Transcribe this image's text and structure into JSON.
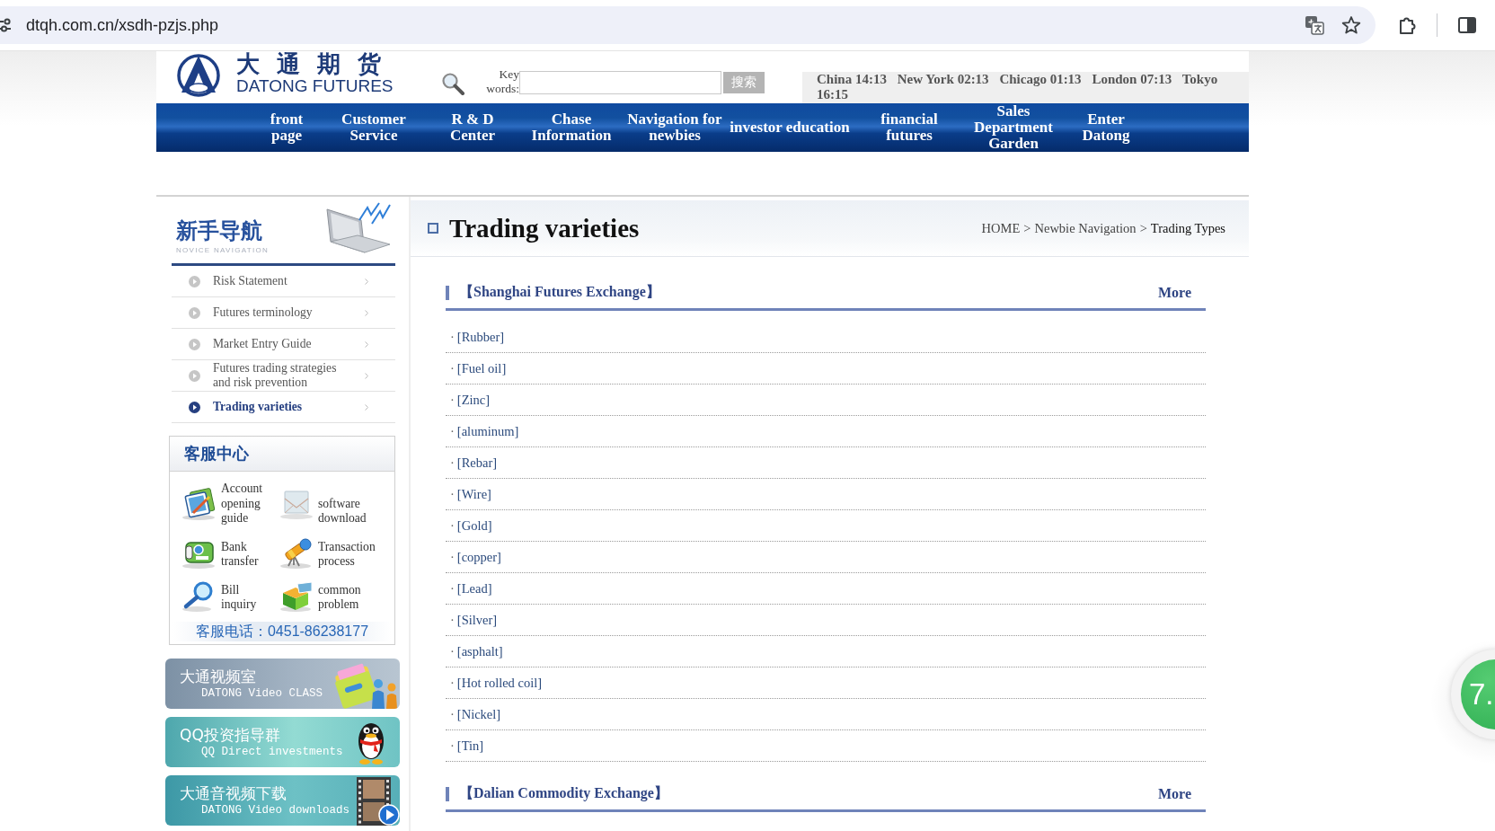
{
  "browser": {
    "url": "dtqh.com.cn/xsdh-pzjs.php"
  },
  "header": {
    "logo": {
      "chinese": "大 通 期 货",
      "english": "DATONG FUTURES"
    },
    "search": {
      "label": "Key words:",
      "button": "搜索"
    },
    "clocks": [
      {
        "city": "China",
        "time": "14:13"
      },
      {
        "city": "New York",
        "time": "02:13"
      },
      {
        "city": "Chicago",
        "time": "01:13"
      },
      {
        "city": "London",
        "time": "07:13"
      },
      {
        "city": "Tokyo",
        "time": "16:15"
      }
    ]
  },
  "nav": [
    "front page",
    "Customer Service",
    "R & D Center",
    "Chase Information",
    "Navigation for newbies",
    "investor education",
    "financial futures",
    "Sales Department Garden",
    "Enter Datong"
  ],
  "sidebar": {
    "heading": {
      "title": "新手导航",
      "subtitle": "NOVICE NAVIGATION"
    },
    "items": [
      {
        "label": "Risk Statement",
        "selected": false
      },
      {
        "label": "Futures terminology",
        "selected": false
      },
      {
        "label": "Market Entry Guide",
        "selected": false
      },
      {
        "label": "Futures trading strategies and risk prevention",
        "selected": false
      },
      {
        "label": "Trading varieties",
        "selected": true
      }
    ],
    "service": {
      "title": "客服中心",
      "links": [
        "Account opening guide",
        "software download",
        "Bank transfer",
        "Transaction process",
        "Bill inquiry",
        "common problem"
      ],
      "phone": "客服电话：0451-86238177"
    },
    "banners": [
      {
        "title": "大通视频室",
        "subtitle": "DATONG Video CLASS"
      },
      {
        "title": "QQ投资指导群",
        "subtitle": "QQ Direct investments"
      },
      {
        "title": "大通音视频下载",
        "subtitle": "DATONG Video downloads"
      }
    ]
  },
  "main": {
    "title": "Trading varieties",
    "breadcrumb": {
      "items": [
        "HOME",
        "Newbie Navigation",
        "Trading Types"
      ],
      "separator": ">"
    },
    "sections": [
      {
        "title": "【Shanghai Futures Exchange】",
        "more": "More",
        "bullet": "·",
        "items": [
          "[Rubber]",
          "[Fuel oil]",
          "[Zinc]",
          "[aluminum]",
          "[Rebar]",
          "[Wire]",
          "[Gold]",
          "[copper]",
          "[Lead]",
          "[Silver]",
          "[asphalt]",
          "[Hot rolled coil]",
          "[Nickel]",
          "[Tin]"
        ]
      },
      {
        "title": "【Dalian Commodity Exchange】",
        "more": "More"
      }
    ]
  },
  "widget": {
    "text": "7."
  }
}
